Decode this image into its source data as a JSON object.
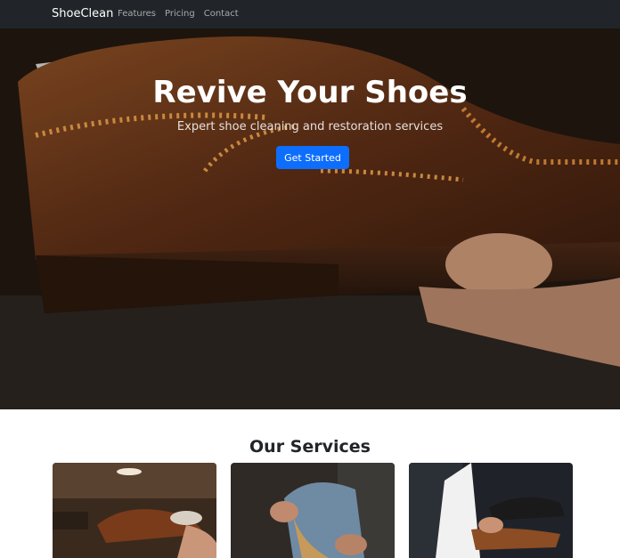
{
  "nav": {
    "brand": "ShoeClean",
    "links": [
      "Features",
      "Pricing",
      "Contact"
    ]
  },
  "hero": {
    "title": "Revive Your Shoes",
    "subtitle": "Expert shoe cleaning and restoration services",
    "cta_label": "Get Started"
  },
  "services": {
    "heading": "Our Services"
  },
  "colors": {
    "navbar": "#212529",
    "primary": "#0d6efd"
  }
}
